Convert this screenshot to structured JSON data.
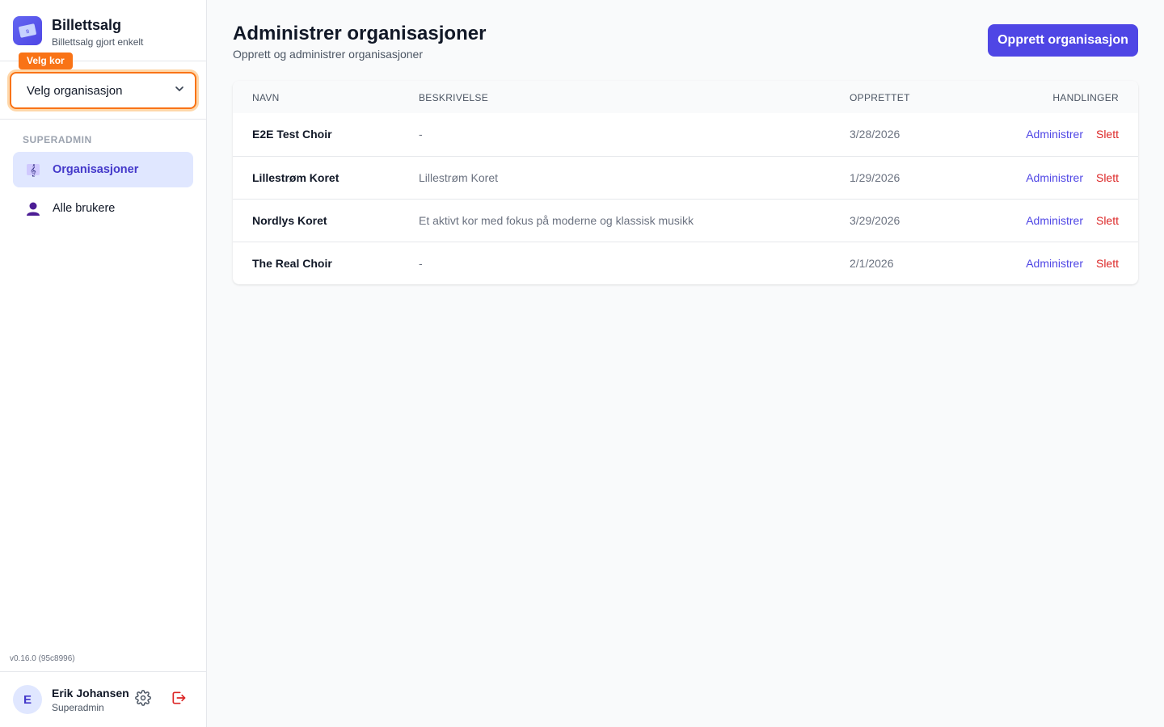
{
  "app": {
    "title": "Billettsalg",
    "tagline": "Billettsalg gjort enkelt",
    "version": "v0.16.0 (95c8996)"
  },
  "org_selector": {
    "badge": "Velg kor",
    "placeholder": "Velg organisasjon"
  },
  "sidebar": {
    "section_label": "SUPERADMIN",
    "items": [
      {
        "label": "Organisasjoner",
        "icon": "music-icon",
        "active": true
      },
      {
        "label": "Alle brukere",
        "icon": "user-icon",
        "active": false
      }
    ]
  },
  "user": {
    "initial": "E",
    "name": "Erik Johansen",
    "role": "Superadmin"
  },
  "page": {
    "title": "Administrer organisasjoner",
    "subtitle": "Opprett og administrer organisasjoner",
    "create_label": "Opprett organisasjon"
  },
  "table": {
    "columns": [
      "NAVN",
      "BESKRIVELSE",
      "OPPRETTET",
      "HANDLINGER"
    ],
    "action_admin": "Administrer",
    "action_delete": "Slett",
    "rows": [
      {
        "name": "E2E Test Choir",
        "description": "-",
        "created": "3/28/2026"
      },
      {
        "name": "Lillestrøm Koret",
        "description": "Lillestrøm Koret",
        "created": "1/29/2026"
      },
      {
        "name": "Nordlys Koret",
        "description": "Et aktivt kor med fokus på moderne og klassisk musikk",
        "created": "3/29/2026"
      },
      {
        "name": "The Real Choir",
        "description": "-",
        "created": "2/1/2026"
      }
    ]
  },
  "colors": {
    "accent": "#4f46e5",
    "warning": "#f97316",
    "danger": "#dc2626"
  }
}
